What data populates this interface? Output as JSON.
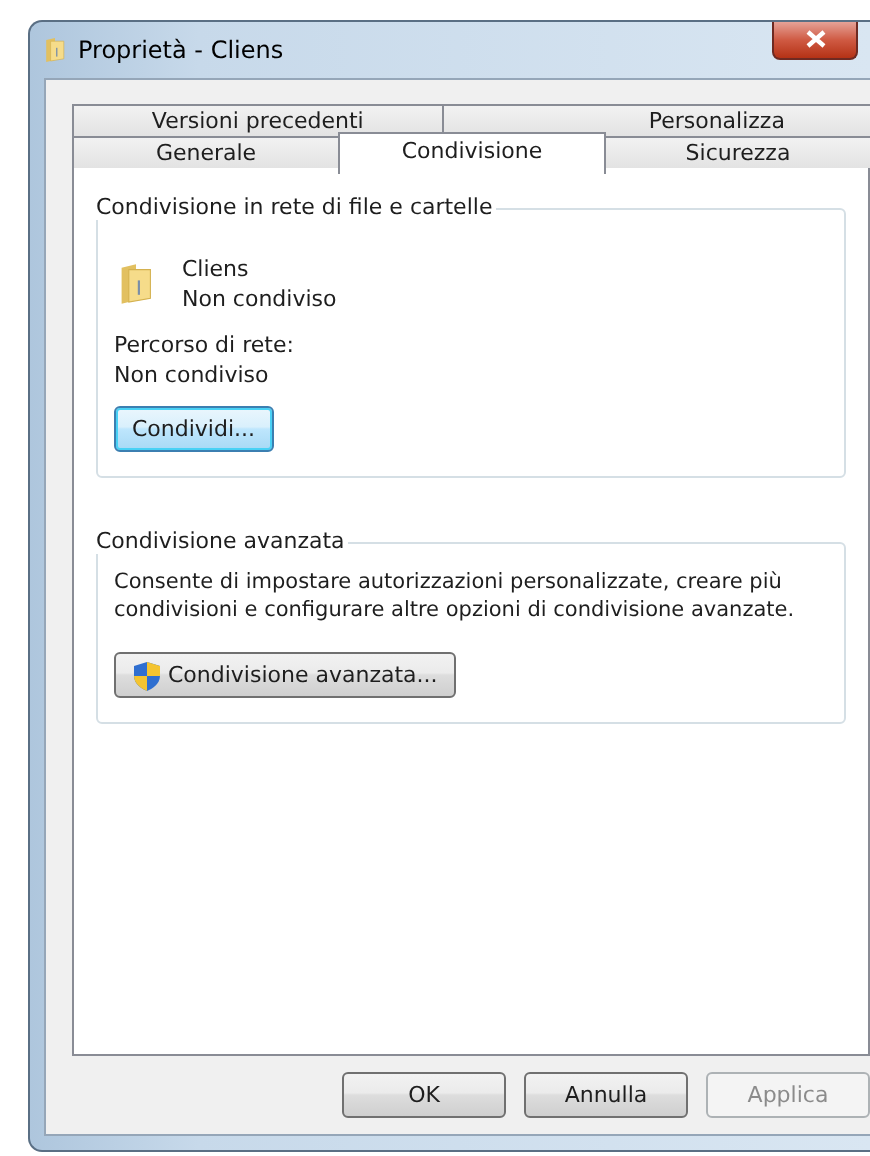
{
  "window": {
    "title": "Proprietà - Cliens",
    "close": {
      "disabled": false
    }
  },
  "tab_rows": [
    {
      "tabs": [
        {
          "label": "Versioni precedenti",
          "selected": false
        },
        {
          "label": "Personalizza",
          "selected": false
        }
      ]
    },
    {
      "tabs": [
        {
          "label": "Generale",
          "selected": false
        },
        {
          "label": "Condivisione",
          "selected": true
        },
        {
          "label": "Sicurezza",
          "selected": false
        }
      ]
    }
  ],
  "network_sharing": {
    "title": "Condivisione in rete di file e cartelle",
    "folder_name": "Cliens",
    "folder_status": "Non condiviso",
    "path_label": "Percorso di rete:",
    "path_value": "Non condiviso",
    "button": {
      "label": "Condividi...",
      "focused": true
    }
  },
  "advanced_sharing": {
    "title": "Condivisione avanzata",
    "description": "Consente di impostare autorizzazioni personalizzate, creare più condivisioni e configurare altre opzioni di condivisione avanzate.",
    "button": {
      "label": "Condivisione avanzata...",
      "focused": false
    }
  },
  "buttons": [
    {
      "label": "OK",
      "disabled": false
    },
    {
      "label": "Annulla",
      "disabled": false
    },
    {
      "label": "Applica",
      "disabled": true
    }
  ]
}
